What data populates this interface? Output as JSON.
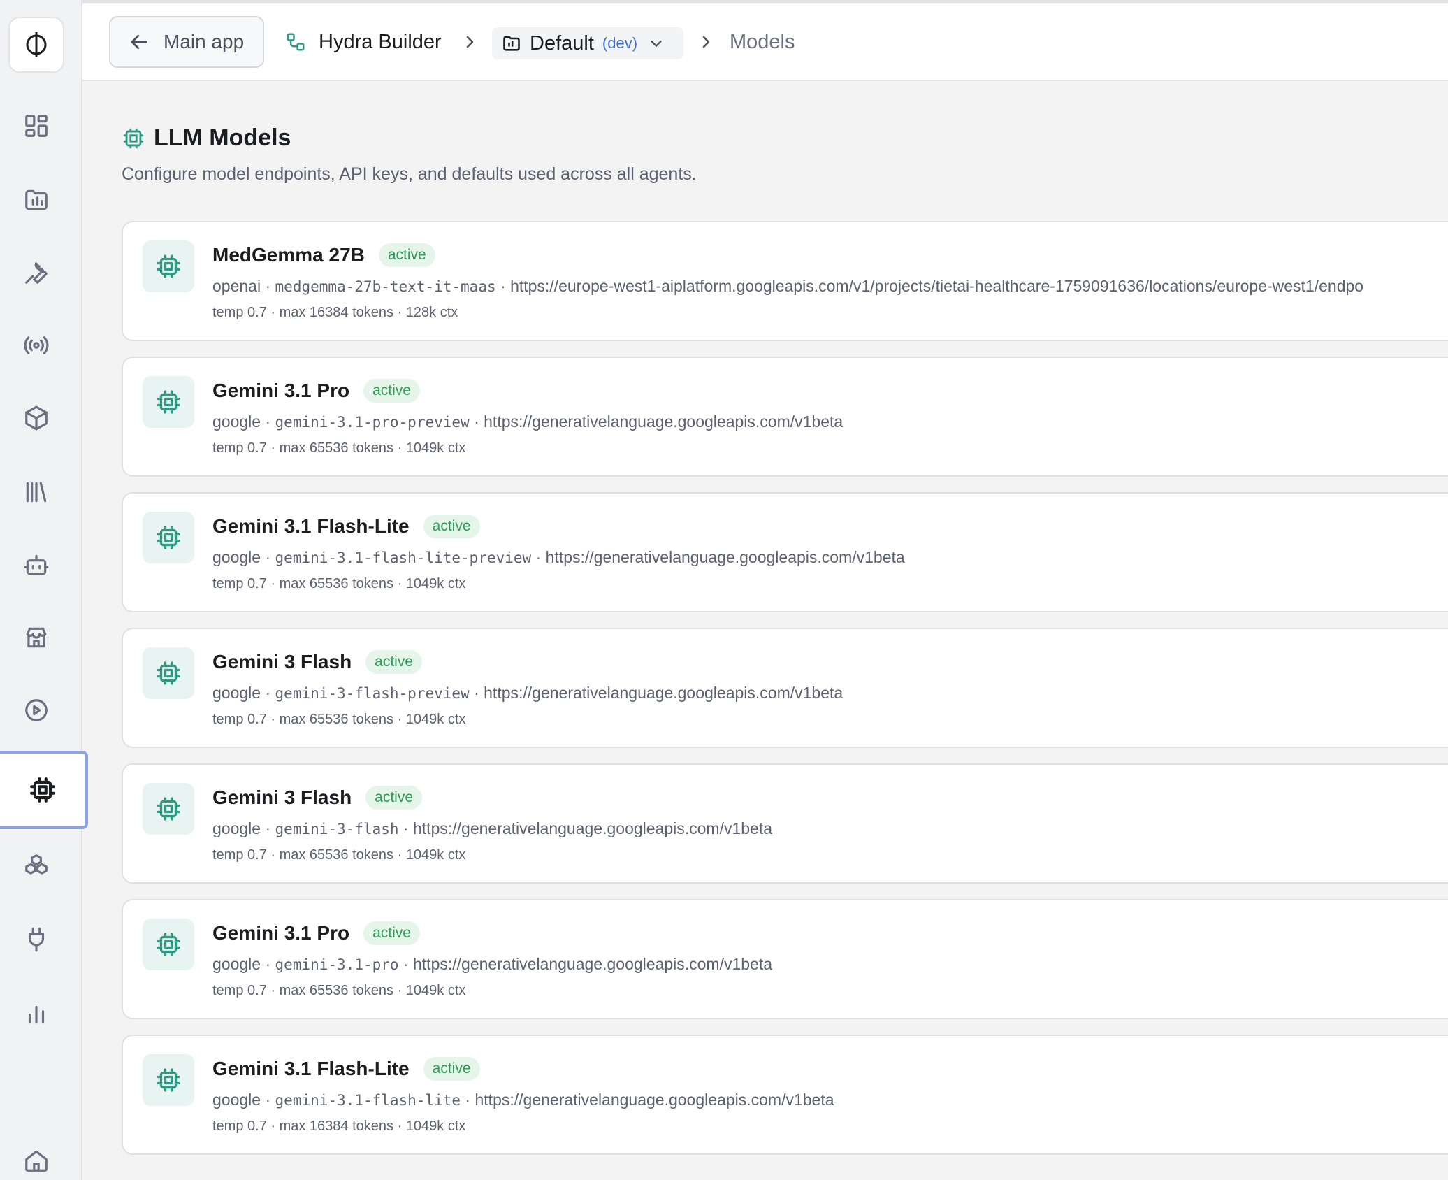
{
  "topbar": {
    "back_label": "Main app",
    "app_name": "Hydra Builder",
    "env_name": "Default",
    "env_tag": "(dev)",
    "current": "Models"
  },
  "page": {
    "title": "LLM Models",
    "subtitle": "Configure model endpoints, API keys, and defaults used across all agents."
  },
  "sidebar": {
    "items": [
      "dashboard-icon",
      "folder-chart-icon",
      "wrench-icon",
      "broadcast-icon",
      "package-icon",
      "library-icon",
      "bot-icon",
      "store-icon",
      "play-circle-icon",
      "cpu-icon",
      "boxes-icon",
      "plug-icon",
      "bar-chart-icon",
      "home-icon"
    ],
    "active": "cpu-icon"
  },
  "models": [
    {
      "name": "MedGemma 27B",
      "status": "active",
      "provider": "openai",
      "model_id": "medgemma-27b-text-it-maas",
      "endpoint": "https://europe-west1-aiplatform.googleapis.com/v1/projects/tietai-healthcare-1759091636/locations/europe-west1/endpo",
      "meta": "temp 0.7 · max 16384 tokens · 128k ctx"
    },
    {
      "name": "Gemini 3.1 Pro",
      "status": "active",
      "provider": "google",
      "model_id": "gemini-3.1-pro-preview",
      "endpoint": "https://generativelanguage.googleapis.com/v1beta",
      "meta": "temp 0.7 · max 65536 tokens · 1049k ctx"
    },
    {
      "name": "Gemini 3.1 Flash-Lite",
      "status": "active",
      "provider": "google",
      "model_id": "gemini-3.1-flash-lite-preview",
      "endpoint": "https://generativelanguage.googleapis.com/v1beta",
      "meta": "temp 0.7 · max 65536 tokens · 1049k ctx"
    },
    {
      "name": "Gemini 3 Flash",
      "status": "active",
      "provider": "google",
      "model_id": "gemini-3-flash-preview",
      "endpoint": "https://generativelanguage.googleapis.com/v1beta",
      "meta": "temp 0.7 · max 65536 tokens · 1049k ctx"
    },
    {
      "name": "Gemini 3 Flash",
      "status": "active",
      "provider": "google",
      "model_id": "gemini-3-flash",
      "endpoint": "https://generativelanguage.googleapis.com/v1beta",
      "meta": "temp 0.7 · max 65536 tokens · 1049k ctx"
    },
    {
      "name": "Gemini 3.1 Pro",
      "status": "active",
      "provider": "google",
      "model_id": "gemini-3.1-pro",
      "endpoint": "https://generativelanguage.googleapis.com/v1beta",
      "meta": "temp 0.7 · max 65536 tokens · 1049k ctx"
    },
    {
      "name": "Gemini 3.1 Flash-Lite",
      "status": "active",
      "provider": "google",
      "model_id": "gemini-3.1-flash-lite",
      "endpoint": "https://generativelanguage.googleapis.com/v1beta",
      "meta": "temp 0.7 · max 16384 tokens · 1049k ctx"
    }
  ]
}
